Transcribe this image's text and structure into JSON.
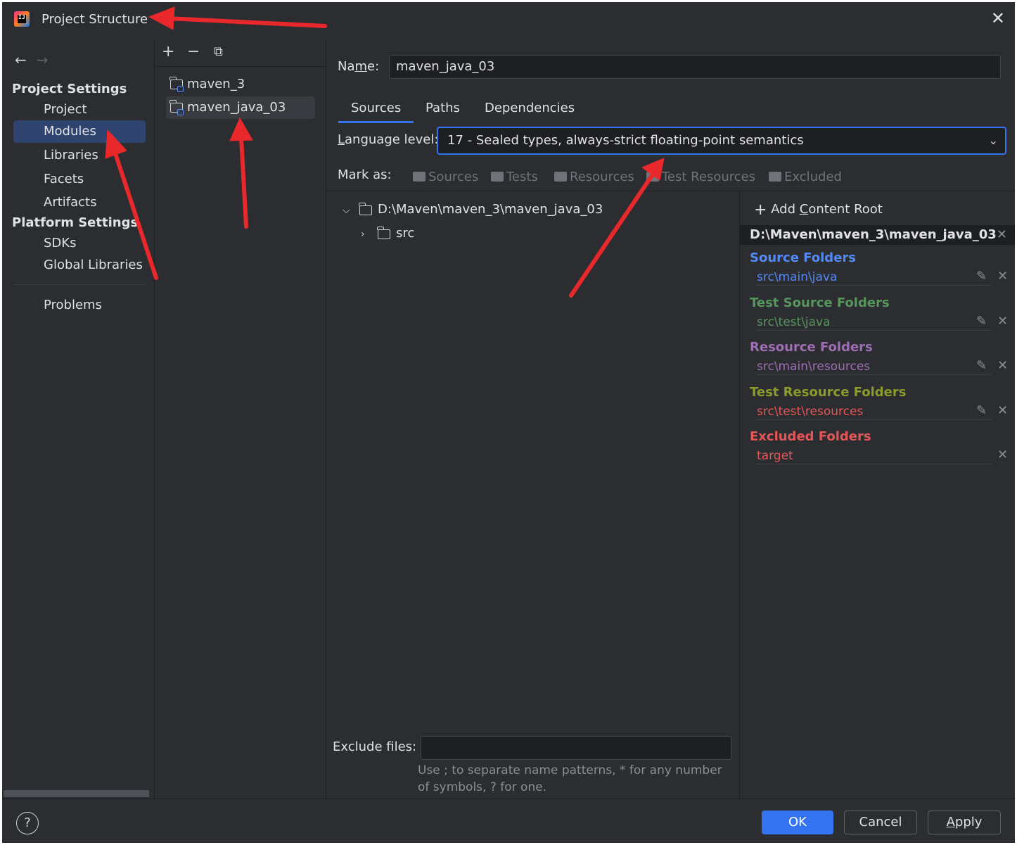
{
  "window": {
    "title": "Project Structure"
  },
  "nav": {
    "back": "←",
    "forward": "→",
    "project_settings": "Project Settings",
    "project_items": [
      "Project",
      "Modules",
      "Libraries",
      "Facets",
      "Artifacts"
    ],
    "platform_settings": "Platform Settings",
    "platform_items": [
      "SDKs",
      "Global Libraries"
    ],
    "problems": "Problems",
    "selected": "Modules"
  },
  "modules": {
    "toolbar": {
      "add": "+",
      "remove": "−",
      "copy": "⧉"
    },
    "items": [
      "maven_3",
      "maven_java_03"
    ],
    "selected": "maven_java_03"
  },
  "main": {
    "name_label_pre": "Na",
    "name_label_mn": "m",
    "name_label_post": "e:",
    "name_value": "maven_java_03",
    "tabs": [
      "Sources",
      "Paths",
      "Dependencies"
    ],
    "active_tab": "Sources",
    "language_label_u": "L",
    "language_label_rest": "anguage level:",
    "language_value": "17 - Sealed types, always-strict floating-point semantics",
    "mark_as_label": "Mark as:",
    "mark_as": [
      "Sources",
      "Tests",
      "Resources",
      "Test Resources",
      "Excluded"
    ],
    "tree": {
      "root": "D:\\Maven\\maven_3\\maven_java_03",
      "child": "src"
    },
    "exclude_label": "Exclude files:",
    "exclude_value": "",
    "exclude_hint": "Use ; to separate name patterns, * for any number of symbols, ? for one."
  },
  "roots": {
    "add_label_pre": "Add ",
    "add_label_u": "C",
    "add_label_post": "ontent Root",
    "path": "D:\\Maven\\maven_3\\maven_java_03",
    "groups": [
      {
        "title": "Source Folders",
        "item": "src\\main\\java",
        "color": "#548af7",
        "editable": true
      },
      {
        "title": "Test Source Folders",
        "item": "src\\test\\java",
        "color": "#57965c",
        "editable": true
      },
      {
        "title": "Resource Folders",
        "item": "src\\main\\resources",
        "color": "#9e6fb5",
        "editable": true
      },
      {
        "title": "Test Resource Folders",
        "item": "src\\test\\resources",
        "color": "#8b9c2a",
        "editable": true
      },
      {
        "title": "Excluded Folders",
        "item": "target",
        "color": "#e55757",
        "editable": false
      }
    ]
  },
  "footer": {
    "help": "?",
    "ok": "OK",
    "cancel": "Cancel",
    "apply": "Apply"
  },
  "colors": {
    "accent": "#3574f0",
    "panel_bg": "#2b2d30",
    "field_bg": "#1e1f22",
    "selection": "#2e436e",
    "annotation": "#e8282b"
  }
}
